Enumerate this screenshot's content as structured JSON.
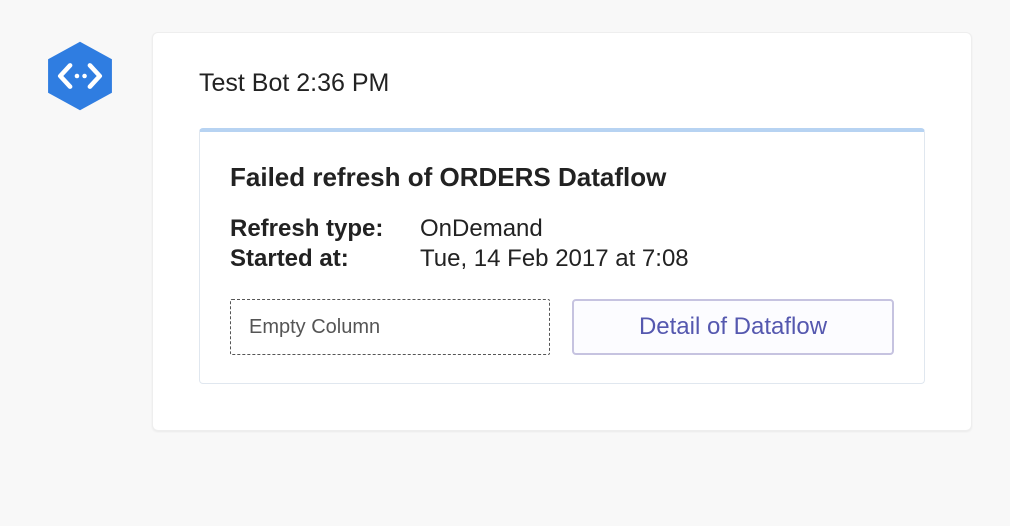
{
  "message": {
    "sender": "Test Bot",
    "timestamp": "2:36 PM"
  },
  "card": {
    "title": "Failed refresh of ORDERS Dataflow",
    "fields": {
      "refreshTypeLabel": "Refresh type:",
      "refreshTypeValue": "OnDemand",
      "startedAtLabel": "Started at:",
      "startedAtValue": "Tue, 14 Feb 2017 at 7:08"
    },
    "emptyColumnLabel": "Empty Column",
    "detailButtonLabel": "Detail of Dataflow"
  }
}
